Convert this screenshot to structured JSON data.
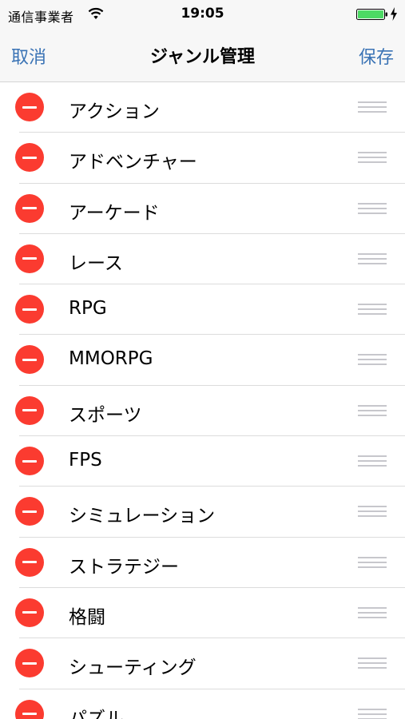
{
  "status_bar": {
    "carrier": "通信事業者",
    "time": "19:05",
    "battery_color": "#4cd964"
  },
  "nav": {
    "cancel_label": "取消",
    "title": "ジャンル管理",
    "save_label": "保存",
    "accent_color": "#3a73b5"
  },
  "genres": [
    {
      "label": "アクション"
    },
    {
      "label": "アドベンチャー"
    },
    {
      "label": "アーケード"
    },
    {
      "label": "レース"
    },
    {
      "label": "RPG"
    },
    {
      "label": "MMORPG"
    },
    {
      "label": "スポーツ"
    },
    {
      "label": "FPS"
    },
    {
      "label": "シミュレーション"
    },
    {
      "label": "ストラテジー"
    },
    {
      "label": "格闘"
    },
    {
      "label": "シューティング"
    },
    {
      "label": "パズル"
    }
  ],
  "icons": {
    "delete": "minus-circle-icon",
    "reorder": "reorder-icon",
    "wifi": "wifi-icon",
    "battery": "battery-icon",
    "charging": "bolt-icon"
  }
}
